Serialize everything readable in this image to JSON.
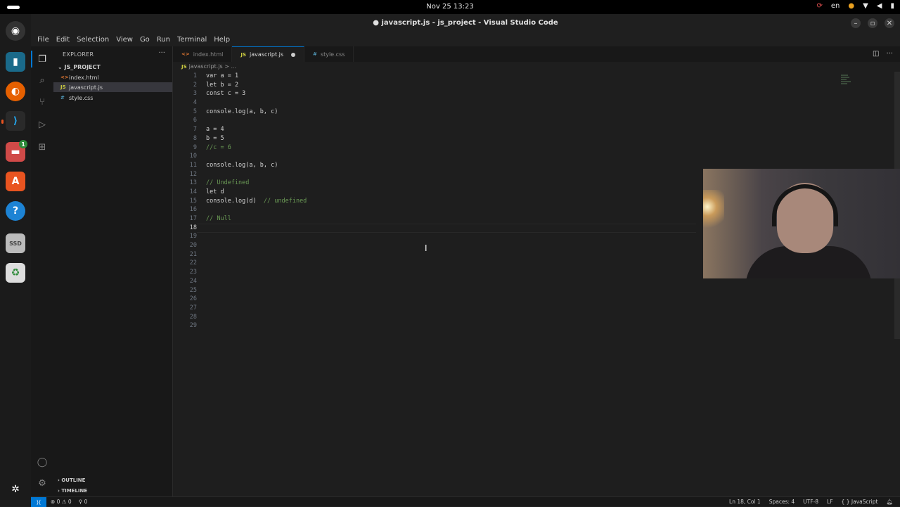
{
  "topbar": {
    "clock": "Nov 25  13:23",
    "lang": "en"
  },
  "window": {
    "title": "● javascript.js - js_project - Visual Studio Code"
  },
  "menu": [
    "File",
    "Edit",
    "Selection",
    "View",
    "Go",
    "Run",
    "Terminal",
    "Help"
  ],
  "explorer": {
    "title": "EXPLORER",
    "project": "JS_PROJECT",
    "files": [
      {
        "icon": "<>",
        "name": "index.html",
        "color": "#e37933"
      },
      {
        "icon": "JS",
        "name": "javascript.js",
        "color": "#cbcb41"
      },
      {
        "icon": "#",
        "name": "style.css",
        "color": "#519aba"
      }
    ],
    "outline": "OUTLINE",
    "timeline": "TIMELINE"
  },
  "tabs": [
    {
      "icon": "<>",
      "label": "index.html",
      "color": "#e37933"
    },
    {
      "icon": "JS",
      "label": "javascript.js",
      "color": "#cbcb41"
    },
    {
      "icon": "#",
      "label": "style.css",
      "color": "#519aba"
    }
  ],
  "breadcrumb": {
    "icon": "JS",
    "file": "javascript.js",
    "rest": "> ..."
  },
  "editor": {
    "lines": [
      "var a = 1",
      "let b = 2",
      "const c = 3",
      "",
      "console.log(a, b, c)",
      "",
      "a = 4",
      "b = 5",
      "//c = 6",
      "",
      "console.log(a, b, c)",
      "",
      "// Undefined",
      "let d",
      "console.log(d)  // undefined",
      "",
      "// Null",
      "",
      "",
      "",
      "",
      "",
      "",
      "",
      "",
      "",
      "",
      "",
      ""
    ],
    "current_line": 18
  },
  "status": {
    "errors": "⊗ 0 ⚠ 0",
    "ports": "⚲ 0",
    "position": "Ln 18, Col 1",
    "spaces": "Spaces: 4",
    "encoding": "UTF-8",
    "eol": "LF",
    "language": "{ } JavaScript"
  }
}
